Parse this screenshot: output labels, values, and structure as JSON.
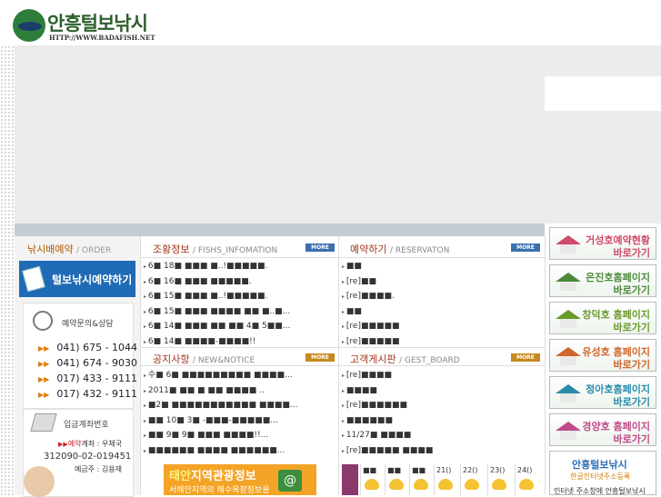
{
  "logo": {
    "name": "안흥털보낚시",
    "url": "HTTP://WWW.BADAFISH.NET"
  },
  "left": {
    "title": "낚시배예약",
    "title_sub": "/ ORDER",
    "reserve_button": "털보낚시예약하기",
    "contact_title": "예약문의&상담",
    "phones": [
      "041) 675 - 1044",
      "041) 674 - 9030",
      "017) 433 - 9111",
      "017) 432 - 9111"
    ],
    "bank_title": "입금계좌번호",
    "bank_label_red": "예약",
    "bank_label": "계좌 : 우체국",
    "bank_number": "312090-02-019451",
    "bank_owner": "예금주 : 김용재"
  },
  "panels": {
    "fish": {
      "title": "조황정보",
      "sub": "/ FISHS_INFOMATION",
      "more": "MORE",
      "rows": [
        "6■ 18■ ■■■ ■..!■■■■■.",
        "6■ 16■ ■■■ ■■■■■.",
        "6■ 15■ ■■■ ■..!■■■■■.",
        "6■ 15■ ■■■ ■■■■ ■■ ■..■...",
        "6■ 14■ ■■■ ■■ ■■ 4■ 5■■...",
        "6■ 14■ ■■■■-■■■■!!"
      ]
    },
    "reserve": {
      "title": "예약하기",
      "sub": "/ RESERVATON",
      "more": "MORE",
      "rows": [
        "■■",
        "[re]■■",
        "[re]■■■■.",
        "■■",
        "[re]■■■■■",
        "[re]■■■■■"
      ]
    },
    "notice": {
      "title": "공지사항",
      "sub": "/ NEW&NOTICE",
      "more": "MORE",
      "rows": [
        "수■ 6■ ■■■■■■■■■ ■■■■...",
        "2011■ ■■ ■ ■■ ■■■■ ..",
        "■2■ ■■■■■■■■■■■ ■■■■...",
        "■■ 10■ 3■ -■■■-■■■■■...",
        "■■ 9■ 9■ ■■■ ■■■■!!...",
        "■■■■■■ ■■■■ ■■■■■■..."
      ]
    },
    "guest": {
      "title": "고객게시판",
      "sub": "/ GEST_BOARD",
      "more": "MORE",
      "rows": [
        "[re]■■■■",
        "■■■■",
        "[re]■■■■■■",
        "■■■■■■",
        "11/27■ ■■■■",
        "[re]■■■■■ ■■■■"
      ]
    }
  },
  "quick_links": [
    {
      "line1": "거성호예약현황",
      "line2": "바로가기",
      "color": "#d04a6a"
    },
    {
      "line1": "은진호홈페이지",
      "line2": "바로가기",
      "color": "#4a8a3a"
    },
    {
      "line1": "창덕호 홈페이지",
      "line2": "바로가기",
      "color": "#6a9a2a"
    },
    {
      "line1": "유성호 홈페이지",
      "line2": "바로가기",
      "color": "#d0662a"
    },
    {
      "line1": "정아호홈페이지",
      "line2": "바로가기",
      "color": "#2a8aaa"
    },
    {
      "line1": "경양호 홈페이지",
      "line2": "바로가기",
      "color": "#c04a8a"
    }
  ],
  "cafe": {
    "line1": "안흥털보낚시",
    "line2": "한글인터넷주소등록",
    "line3": "인터넷 주소창에 안흥털보낚시"
  },
  "tour": {
    "big": "태안",
    "rest": "지역관광정보",
    "sub": "서해안지역의 해수욕장정보를",
    "icon": "@"
  },
  "tide": {
    "days": [
      "■■",
      "■■",
      "■■",
      "21()",
      "22()",
      "23()",
      "24()"
    ]
  }
}
